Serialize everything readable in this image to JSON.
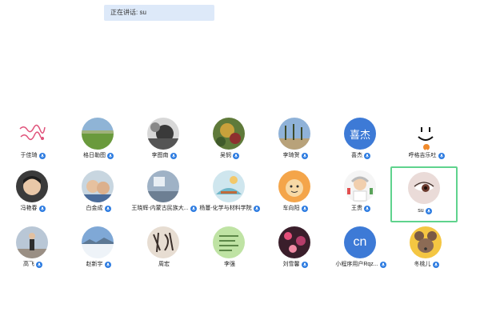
{
  "speaking": {
    "label": "正在讲话: su",
    "color": "#dde9f9"
  },
  "accent": {
    "badge": "#2f7de1",
    "active_border": "#5fd38d"
  },
  "participants": [
    {
      "name": "于佳琦",
      "icon": "handwritten-text-avatar",
      "badge": "mic-badge"
    },
    {
      "name": "格日勒图",
      "icon": "landscape-avatar",
      "badge": "mic-badge"
    },
    {
      "name": "李图南",
      "icon": "monochrome-portrait-avatar",
      "badge": "mic-badge"
    },
    {
      "name": "吴悯",
      "icon": "flower-photo-avatar",
      "badge": "mic-badge"
    },
    {
      "name": "李琦贺",
      "icon": "trees-photo-avatar",
      "badge": "mic-badge"
    },
    {
      "name": "喜杰",
      "avatar_text": "喜杰",
      "icon": "text-avatar",
      "badge": "mic-badge"
    },
    {
      "name": "呼格吉乐吐",
      "icon": "smiley-face-avatar",
      "badge": "user-badge"
    },
    {
      "name": "冯艳春",
      "icon": "child-portrait-avatar",
      "badge": "mic-badge"
    },
    {
      "name": "白金成",
      "icon": "kids-photo-avatar",
      "badge": "mic-badge"
    },
    {
      "name": "王晓辉-内蒙古民族大...",
      "icon": "room-photo-avatar",
      "badge": "mic-badge"
    },
    {
      "name": "杨蔓-化学与材料学院",
      "icon": "illustration-avatar",
      "badge": "mic-badge"
    },
    {
      "name": "车向阳",
      "icon": "cartoon-avatar",
      "badge": "mic-badge"
    },
    {
      "name": "王贵",
      "icon": "scientist-cartoon-avatar",
      "badge": "mic-badge"
    },
    {
      "name": "su",
      "icon": "eye-closeup-avatar",
      "badge": "mic-badge",
      "active": true
    },
    {
      "name": "高飞",
      "icon": "person-outdoor-avatar",
      "badge": "mic-badge"
    },
    {
      "name": "赵新宇",
      "icon": "winter-lake-avatar",
      "badge": "mic-badge"
    },
    {
      "name": "周宏",
      "icon": "calligraphy-avatar",
      "badge": "none"
    },
    {
      "name": "李强",
      "icon": "green-handwriting-avatar",
      "badge": "none"
    },
    {
      "name": "刘雪馨",
      "icon": "bokeh-photo-avatar",
      "badge": "mic-badge"
    },
    {
      "name": "小程序用户Rqz...",
      "avatar_text": "cn",
      "icon": "text-avatar",
      "badge": "mic-badge"
    },
    {
      "name": "冬桃儿",
      "icon": "mouse-cartoon-avatar",
      "badge": "mic-badge"
    }
  ]
}
